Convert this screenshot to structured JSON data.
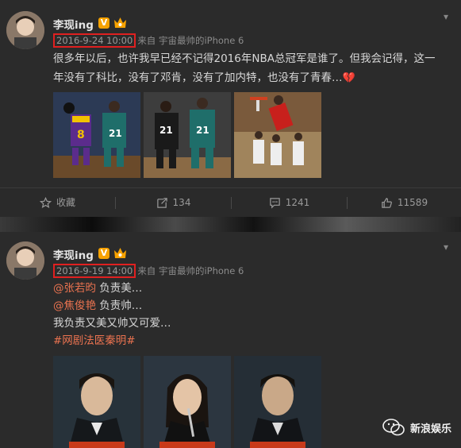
{
  "posts": [
    {
      "author": "李现ing",
      "verified_badge": "V",
      "time": "2016-9-24 10:00",
      "source": "来自 宇宙最帅的iPhone 6",
      "text_line1": "很多年以后，也许我早已经不记得2016年NBA总冠军是谁了。但我会记得，这一",
      "text_line2": "年没有了科比，没有了邓肯，没有了加内特，也没有了青春…",
      "text_emoji": "💔",
      "images": [
        {
          "icon": "basketball-photo-kobe-garnett"
        },
        {
          "icon": "basketball-photo-duncan-garnett"
        },
        {
          "icon": "basketball-photo-dunk"
        }
      ],
      "actions": {
        "favorite_label": "收藏",
        "repost_count": "134",
        "comment_count": "1241",
        "like_count": "11589"
      }
    },
    {
      "author": "李现ing",
      "verified_badge": "V",
      "time": "2016-9-19 14:00",
      "source": "来自 宇宙最帅的iPhone 6",
      "mention1": "@张若昀",
      "mention1_text": " 负责美…",
      "mention2": "@焦俊艳",
      "mention2_text": " 负责帅…",
      "line3": "我负责又美又帅又可爱…",
      "topic": "#网剧法医秦明#",
      "images": [
        {
          "icon": "drama-poster-man-1"
        },
        {
          "icon": "drama-poster-woman"
        },
        {
          "icon": "drama-poster-man-2"
        }
      ]
    }
  ],
  "watermark": "新浪娱乐",
  "colors": {
    "background": "#2b2b2b",
    "accent_orange": "#eb7350",
    "highlight_box": "#e02020",
    "badge": "#f7a200"
  }
}
